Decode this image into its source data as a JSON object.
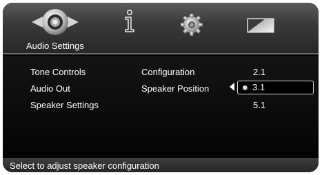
{
  "tabs": {
    "audio": {
      "label": "Audio Settings",
      "icon": "speaker-icon"
    },
    "info": {
      "icon": "info-icon"
    },
    "settings": {
      "icon": "gear-icon"
    },
    "display": {
      "icon": "display-icon"
    }
  },
  "menu": {
    "col1": [
      "Tone Controls",
      "Audio Out",
      "Speaker Settings"
    ],
    "col2": [
      "Configuration",
      "Speaker Position"
    ],
    "options": [
      "2.1",
      "3.1",
      "5.1"
    ],
    "selected_option": "3.1"
  },
  "status": "Select to adjust speaker configuration"
}
